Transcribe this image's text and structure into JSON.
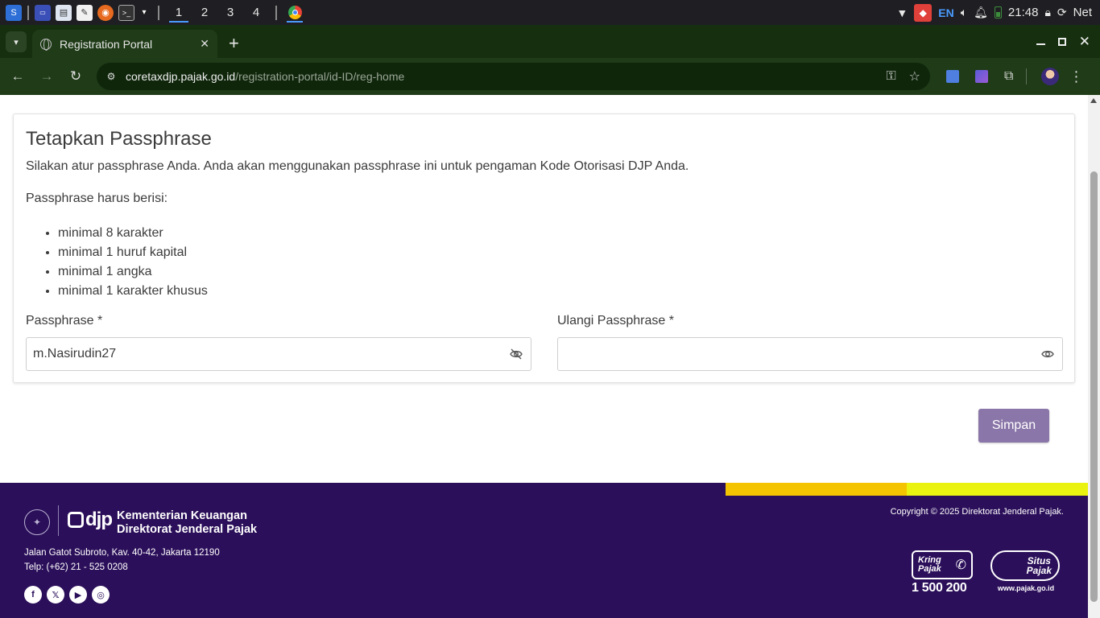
{
  "os_taskbar": {
    "workspaces": [
      "1",
      "2",
      "3",
      "4"
    ],
    "active_workspace": "1",
    "language": "EN",
    "time": "21:48",
    "network_label": "Net"
  },
  "browser": {
    "tab_title": "Registration Portal",
    "url_domain": "coretaxdjp.pajak.go.id",
    "url_path": "/registration-portal/id-ID/reg-home",
    "theme_color": "#1f3b17"
  },
  "form": {
    "title": "Tetapkan Passphrase",
    "description": "Silakan atur passphrase Anda. Anda akan menggunakan passphrase ini untuk pengaman Kode Otorisasi DJP Anda.",
    "requirements_intro": "Passphrase harus berisi:",
    "requirements": [
      "minimal 8 karakter",
      "minimal 1 huruf kapital",
      "minimal 1 angka",
      "minimal 1 karakter khusus"
    ],
    "passphrase_label": "Passphrase *",
    "passphrase_value": "m.Nasirudin27",
    "passphrase_visibility": "visible",
    "confirm_label": "Ulangi Passphrase *",
    "confirm_value": "",
    "confirm_visibility": "hidden",
    "save_label": "Simpan",
    "save_color": "#8a76a8"
  },
  "footer": {
    "background": "#2b0f5a",
    "logo_text": "djp",
    "org_line1": "Kementerian Keuangan",
    "org_line2": "Direktorat Jenderal Pajak",
    "address": "Jalan Gatot Subroto, Kav. 40-42, Jakarta 12190",
    "phone": "Telp: (+62) 21 - 525 0208",
    "copyright": "Copyright © 2025 Direktorat Jenderal Pajak.",
    "socials": [
      "facebook-icon",
      "x-icon",
      "youtube-icon",
      "instagram-icon"
    ],
    "kring_line1": "Kring",
    "kring_line2": "Pajak",
    "kring_number": "1 500 200",
    "situs_line1": "Situs",
    "situs_line2": "Pajak",
    "situs_url": "www.pajak.go.id"
  }
}
